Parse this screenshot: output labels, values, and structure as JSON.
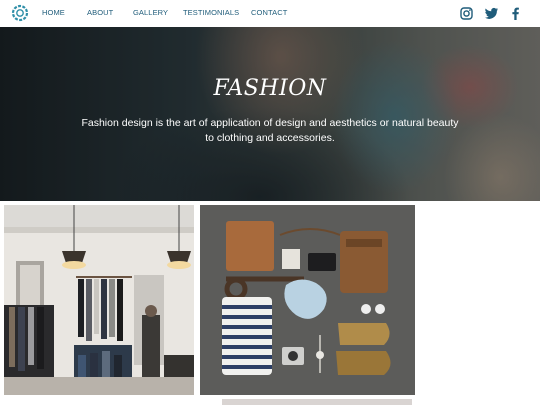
{
  "nav": {
    "logo_icon": "circular-logo-icon",
    "links": [
      "HOME",
      "ABOUT",
      "GALLERY",
      "TESTIMONIALS",
      "CONTACT"
    ],
    "social": [
      "instagram-icon",
      "twitter-icon",
      "facebook-icon"
    ],
    "link_color": "#1f5c7a"
  },
  "hero": {
    "title": "FASHION",
    "text": "Fashion design is the art of application of design and aesthetics or natural beauty to clothing and accessories."
  },
  "gallery": {
    "images": [
      "clothing-store-photo",
      "fashion-flatlay-photo"
    ]
  }
}
